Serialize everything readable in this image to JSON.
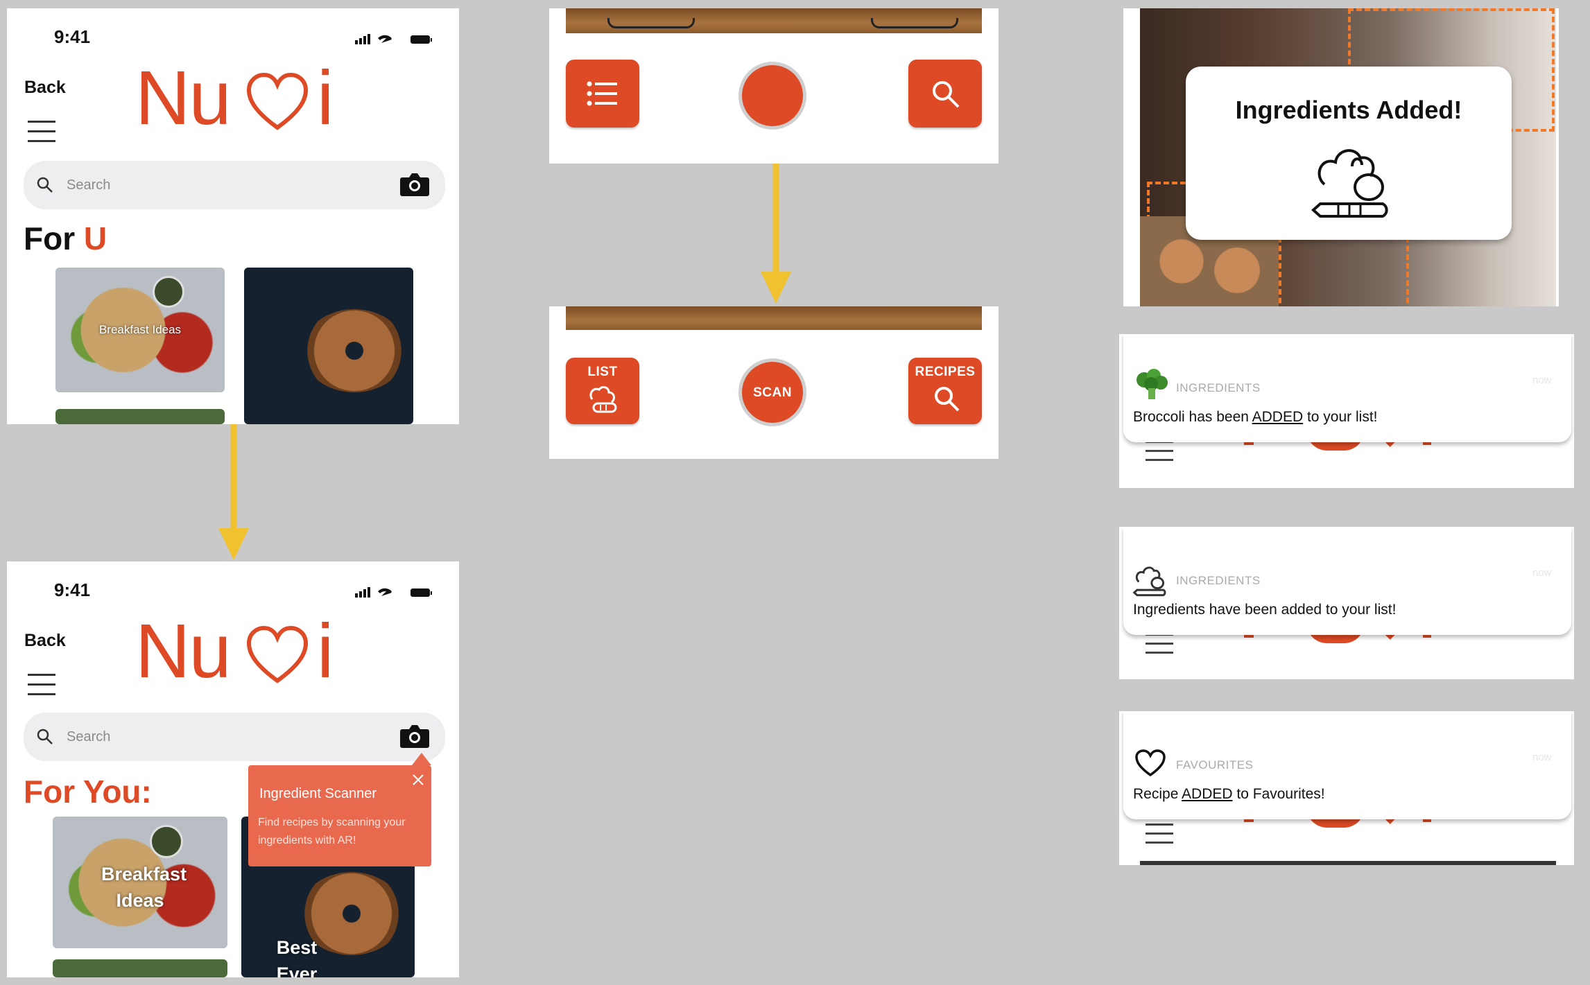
{
  "status_time": "9:41",
  "back_label": "Back",
  "logo_text": "Nu",
  "logo_text_end": "i",
  "search_placeholder": "Search",
  "screen1": {
    "for_word": "For",
    "u_word": "U",
    "card1_label": "Breakfast Ideas"
  },
  "screen2": {
    "title": "For You:",
    "card1_label": "Breakfast Ideas",
    "card2_label": "Best Ever",
    "tooltip_title": "Ingredient Scanner",
    "tooltip_text": "Find recipes by scanning your ingredients with AR!"
  },
  "scanner_bar": {
    "list_label": "LIST",
    "scan_label": "SCAN",
    "recipes_label": "RECIPES"
  },
  "ingredients_popup": {
    "title": "Ingredients Added!"
  },
  "notifications": [
    {
      "category": "INGREDIENTS",
      "pre": "Broccoli has been ",
      "emph": "ADDED",
      "post": " to your list!",
      "time": "now"
    },
    {
      "category": "INGREDIENTS",
      "pre": "Ingredients have been added to your list!",
      "emph": "",
      "post": "",
      "time": "now"
    },
    {
      "category": "FAVOURITES",
      "pre": "Recipe ",
      "emph": "ADDED",
      "post": " to Favourites!",
      "time": "now"
    }
  ],
  "colors": {
    "brand": "#dd4a25",
    "arrow": "#f0c22f",
    "background": "#c9c9c9",
    "tooltip": "#e9694f"
  }
}
